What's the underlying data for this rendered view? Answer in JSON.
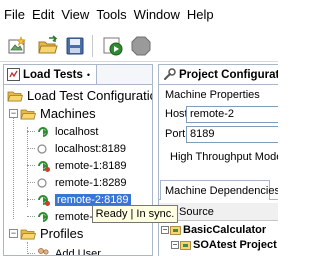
{
  "menubar": {
    "items": [
      "File",
      "Edit",
      "View",
      "Tools",
      "Window",
      "Help"
    ]
  },
  "toolbar": {
    "buttons": [
      "new-project-icon",
      "open-folder-icon",
      "save-disk-icon",
      "run-icon",
      "stop-icon"
    ]
  },
  "left_view": {
    "tab_label": "Load Tests",
    "tab_pin": "•",
    "tree": {
      "root": "Load Test Configuration",
      "machines": "Machines",
      "machine_items": [
        "localhost",
        "localhost:8189",
        "remote-1:8189",
        "remote-1:8289",
        "remote-2:8189",
        "remote-3:8189"
      ],
      "profiles": "Profiles",
      "profile_items": [
        "Add User"
      ]
    }
  },
  "tooltip": {
    "text": "Ready | In sync."
  },
  "right_view": {
    "tab_label": "Project Configuratio",
    "section_title": "Machine Properties",
    "host_label": "Host",
    "host_value": "remote-2",
    "port_label": "Port",
    "port_value": "8189",
    "high_throughput_label": "High Throughput Mode",
    "dependencies_tab": "Machine Dependencies",
    "source_header": "Source",
    "rows": [
      "BasicCalculator",
      "SOAtest Project"
    ]
  },
  "colors": {
    "selection": "#3875d7",
    "tooltip_bg": "#ffffe1",
    "border": "#a9b7c9"
  }
}
